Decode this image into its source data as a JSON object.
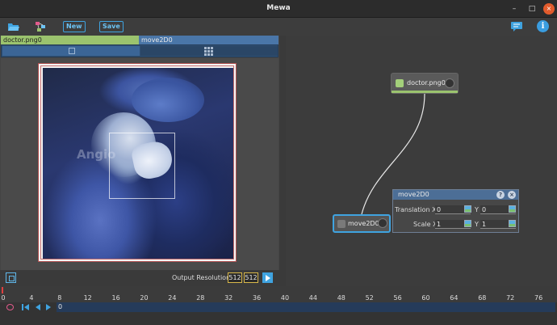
{
  "window": {
    "title": "Mewa"
  },
  "toolbar": {
    "new_label": "New",
    "save_label": "Save"
  },
  "tabs": {
    "doctor": "doctor.png0",
    "move": "move2D0"
  },
  "viewer": {
    "watermark": "Angio"
  },
  "status": {
    "output_label": "Output Resolution:",
    "res_w": "512",
    "res_sep": "",
    "res_h": "512"
  },
  "graph": {
    "nodes": {
      "doctor": "doctor.png0",
      "move": "move2D0"
    },
    "panel": {
      "title": "move2D0",
      "translation_label": "Translation X",
      "tx": "0",
      "ty_label": "Y",
      "ty": "0",
      "scale_label": "Scale X",
      "sx": "1",
      "sy_label": "Y",
      "sy": "1"
    }
  },
  "timeline": {
    "ticks": [
      "0",
      "4",
      "8",
      "12",
      "16",
      "20",
      "24",
      "28",
      "32",
      "36",
      "40",
      "44",
      "48",
      "52",
      "56",
      "60",
      "64",
      "68",
      "72",
      "76"
    ],
    "frame": "0"
  },
  "colors": {
    "accent": "#3fa3e0",
    "node_green": "#9bc36e",
    "tab_blue": "#4a76a8"
  }
}
